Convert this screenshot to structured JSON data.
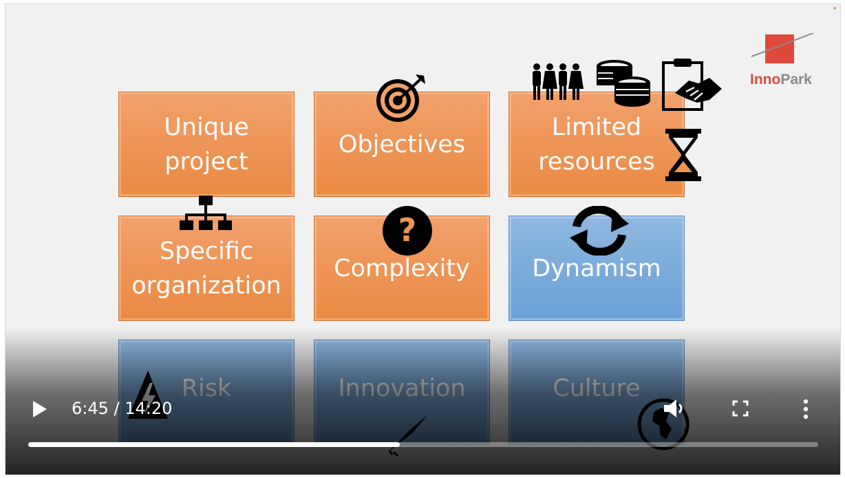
{
  "tiles": [
    {
      "id": "unique-project",
      "lines": [
        "Unique",
        "project"
      ],
      "color": "orange"
    },
    {
      "id": "objectives",
      "lines": [
        "Objectives"
      ],
      "color": "orange"
    },
    {
      "id": "limited-resources",
      "lines": [
        "Limited",
        "resources"
      ],
      "color": "orange"
    },
    {
      "id": "specific-organization",
      "lines": [
        "Specific",
        "organization"
      ],
      "color": "orange"
    },
    {
      "id": "complexity",
      "lines": [
        "Complexity"
      ],
      "color": "orange"
    },
    {
      "id": "dynamism",
      "lines": [
        "Dynamism"
      ],
      "color": "blue"
    },
    {
      "id": "risk",
      "lines": [
        "Risk"
      ],
      "color": "blue"
    },
    {
      "id": "innovation",
      "lines": [
        "Innovation"
      ],
      "color": "blue"
    },
    {
      "id": "culture",
      "lines": [
        "Culture"
      ],
      "color": "blue"
    }
  ],
  "logo": {
    "part1": "Inno",
    "part2": "Park"
  },
  "player": {
    "time_display": "6:45 / 14:20",
    "current_time": "6:45",
    "duration": "14:20",
    "progress_fraction": 0.47,
    "play_icon": "play-icon",
    "volume_icon": "volume-icon",
    "fullscreen_icon": "fullscreen-icon",
    "more_icon": "more-vert-icon"
  },
  "colors": {
    "orange": "#ee9451",
    "blue": "#72a5d9",
    "logo_red": "#e0483c",
    "logo_gray": "#8a8a8a"
  }
}
